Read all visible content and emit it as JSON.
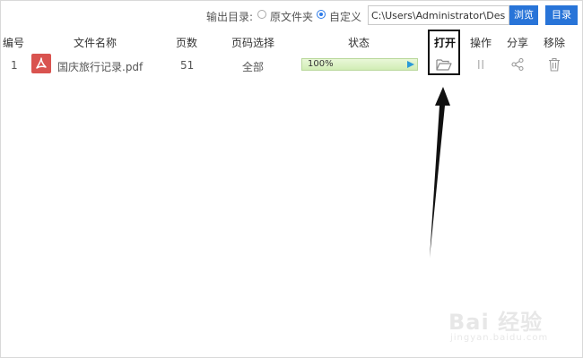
{
  "output": {
    "label": "输出目录:",
    "option_original": "原文件夹",
    "option_custom": "自定义",
    "selected": "custom",
    "path_value": "C:\\Users\\Administrator\\Desktop",
    "browse_label": "浏览",
    "directory_label": "目录"
  },
  "table": {
    "headers": {
      "number": "编号",
      "filename": "文件名称",
      "pages": "页数",
      "page_select": "页码选择",
      "status": "状态",
      "open": "打开",
      "operation": "操作",
      "share": "分享",
      "remove": "移除"
    },
    "rows": [
      {
        "number": "1",
        "filename": "国庆旅行记录.pdf",
        "pages": "51",
        "page_select": "全部",
        "progress_text": "100%",
        "progress": 100
      }
    ]
  },
  "icons": {
    "file_type": "pdf-icon",
    "open": "folder-open-icon",
    "operation": "pause-icon",
    "share": "share-icon",
    "remove": "trash-icon",
    "progress_action": "play-icon"
  },
  "colors": {
    "accent": "#2874d8",
    "pdf_red": "#d9534f",
    "progress_green": "#d1edb4",
    "annotation": "#111111"
  },
  "watermark": {
    "logo": "Bai 经验",
    "url": "jingyan.baidu.com"
  }
}
